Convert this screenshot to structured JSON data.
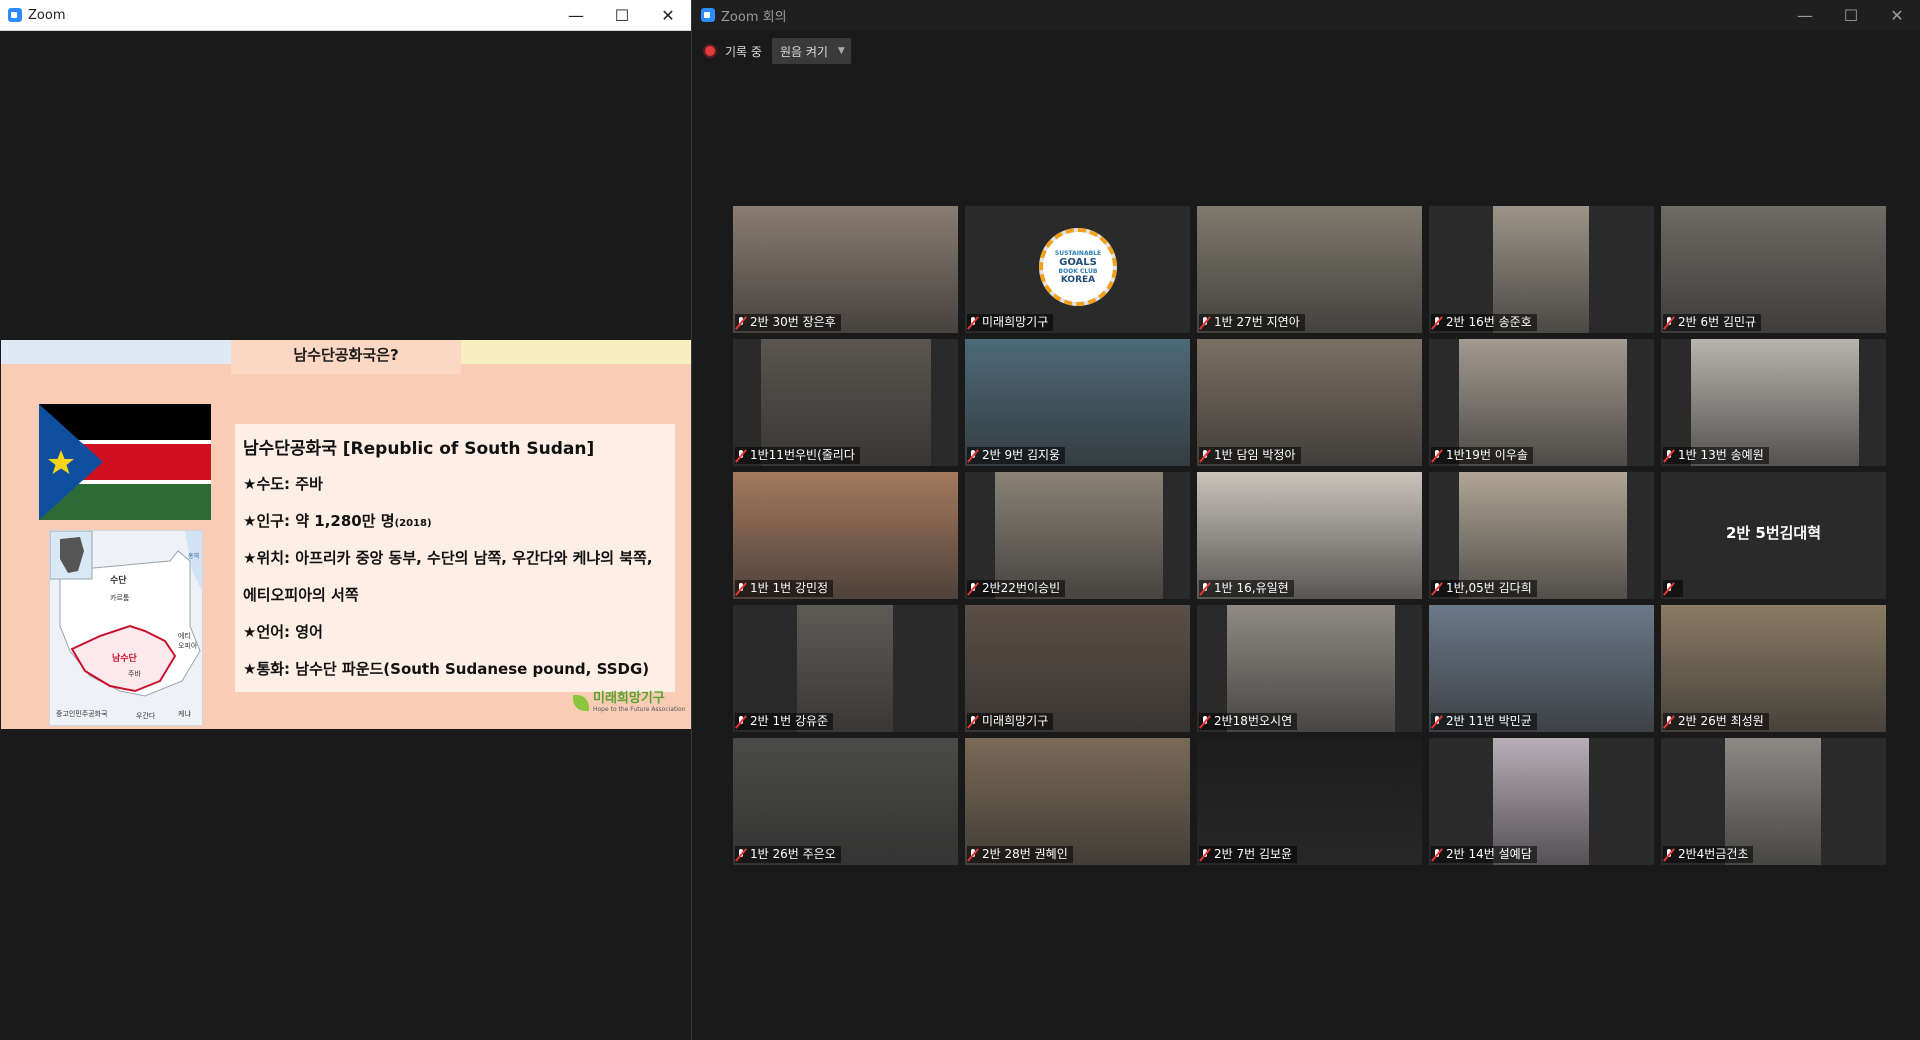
{
  "share_window": {
    "title": "Zoom"
  },
  "window_controls": {
    "minimize": "—",
    "maximize": "☐",
    "close": "✕"
  },
  "slide": {
    "title": "남수단공화국은?",
    "heading": "남수단공화국 [Republic of South Sudan]",
    "capital": "★수도: 주바",
    "population": "★인구: 약 1,280만 명",
    "population_year": "(2018)",
    "location_1": "★위치: 아프리카 중앙 동부, 수단의 남쪽, 우간다와 케냐의 북쪽,",
    "location_2": "에티오피아의 서쪽",
    "language": "★언어: 영어",
    "currency": "★통화: 남수단 파운드(South Sudanese pound, SSDG)",
    "map_labels": {
      "sudan": "수단",
      "khartoum": "카르툼",
      "south_sudan": "남수단",
      "juba": "주바",
      "ethiopia": "에티\n오피아",
      "car": "중고인민주공화국",
      "uganda": "우간다",
      "kenya": "케냐",
      "sea": "홍해"
    },
    "logo_ko": "미래희망기구",
    "logo_en": "Hope to the Future Association",
    "flag_colors": {
      "black": "#000000",
      "red": "#cf1020",
      "green": "#2c6b35",
      "blue": "#0f4fa0",
      "star": "#f7d417"
    }
  },
  "gallery_window": {
    "title": "Zoom 회의",
    "recording_label": "기록 중",
    "view_button": "원음 켜기"
  },
  "participants": [
    [
      "2반 30번 장은후",
      "미래희망기구",
      "1반 27번 지연아",
      "2반 16번 송준호",
      "2반 6번 김민규"
    ],
    [
      "1반11번우빈(줄리다",
      "2반 9번 김지웅",
      "1반 담임 박정아",
      "1반19번 이우솔",
      "1반 13번 송예원"
    ],
    [
      "1반 1번 강민정",
      "2반22번이승빈",
      "1반 16,유일현",
      "1반,05번 김다희",
      "2반 5번김대혁"
    ],
    [
      "2반 1번 강유준",
      "미래희망기구",
      "2반18번오시연",
      "2반 11번 박민균",
      "2반 26번 최성원"
    ],
    [
      "1반 26번 주은오",
      "2반 28번 권혜인",
      "2반 7번 김보윤",
      "2반 14번 설예담",
      "2반4번금건초"
    ]
  ],
  "bookclub_logo": {
    "line1": "SUSTAINABLE",
    "line2": "GOALS",
    "line3": "BOOK CLUB",
    "line4": "KOREA"
  }
}
